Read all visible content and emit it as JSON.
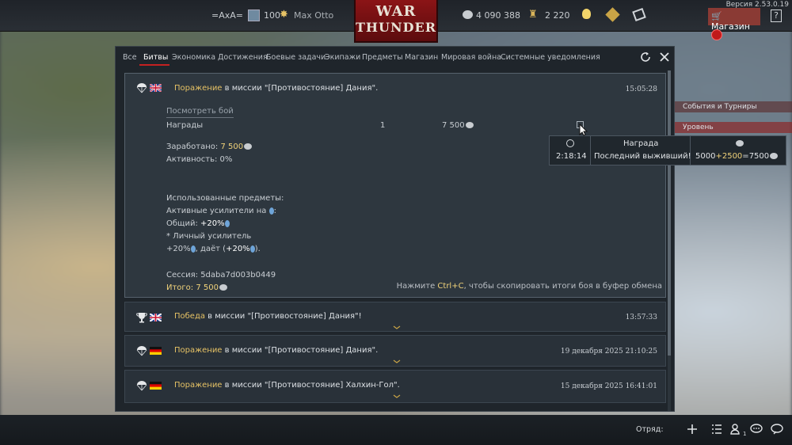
{
  "version": "Версия 2.53.0.19",
  "topbar": {
    "clan_tag": "=AxA=",
    "level": "100",
    "player_name": "Max Otto",
    "logo_line1": "WAR",
    "logo_line2": "THUNDER",
    "silver_lions": "4 090 388",
    "golden_eagles": "2 220",
    "shop_label": "Магазин",
    "help_label": "?"
  },
  "tabs": [
    {
      "label": "Все"
    },
    {
      "label": "Битвы"
    },
    {
      "label": "Экономика"
    },
    {
      "label": "Достижения"
    },
    {
      "label": "Боевые задачи"
    },
    {
      "label": "Экипажи"
    },
    {
      "label": "Предметы"
    },
    {
      "label": "Магазин"
    },
    {
      "label": "Мировая война"
    },
    {
      "label": "Системные уведомления"
    }
  ],
  "battles": [
    {
      "status": "Поражение",
      "text": " в миссии \"[Противостояние] Дания\".",
      "time": "15:05:28",
      "icon": "parachute-icon",
      "flag": "uk-flag"
    },
    {
      "status": "Победа",
      "text": " в миссии \"[Противостояние] Дания\"!",
      "time": "13:57:33",
      "icon": "trophy-icon",
      "flag": "uk-flag"
    },
    {
      "status": "Поражение",
      "text": " в миссии \"[Противостояние] Дания\".",
      "time": "19 декабря 2025 21:10:25",
      "icon": "parachute-icon",
      "flag": "germany-flag"
    },
    {
      "status": "Поражение",
      "text": " в миссии \"[Противостояние] Халхин-Гол\".",
      "time": "15 декабря 2025 16:41:01",
      "icon": "parachute-icon",
      "flag": "germany-flag"
    }
  ],
  "details": {
    "view_battle": "Посмотреть бой",
    "rewards_label": "Награды",
    "rewards_count": "1",
    "rewards_value": "7 500",
    "earned_label": "Заработано: ",
    "earned_value": "7 500",
    "activity": "Активность: 0%",
    "used_items": "Использованные предметы:",
    "active_boosters": "Активные усилители на ",
    "general_label": "Общий: ",
    "general_value": "+20%",
    "personal_booster": "* Личный усилитель",
    "personal_value": "+20%",
    "gives_label": ", даёт (",
    "gives_value": "+20%",
    "session": "Сессия: 5daba7d003b0449",
    "total_label": "Итого: ",
    "total_value": "7 500",
    "copy_hint_pre": "Нажмите ",
    "copy_hint_key": "Ctrl+C",
    "copy_hint_post": ", чтобы скопировать итоги боя в буфер обмена"
  },
  "tooltip": {
    "time": "2:18:14",
    "reward_header": "Награда",
    "reward_name": "Последний выживший!",
    "calc_base": "5000",
    "calc_bonus": "2500",
    "calc_total": "7500"
  },
  "side_menu": {
    "events": "События и Турниры",
    "levels": "Уровень"
  },
  "bottombar": {
    "squad_label": "Отряд:",
    "friends_count": "1"
  },
  "colors": {
    "accent_red": "#c42121",
    "status_yellow": "#e6c265",
    "highlight": "#f0d27a"
  }
}
